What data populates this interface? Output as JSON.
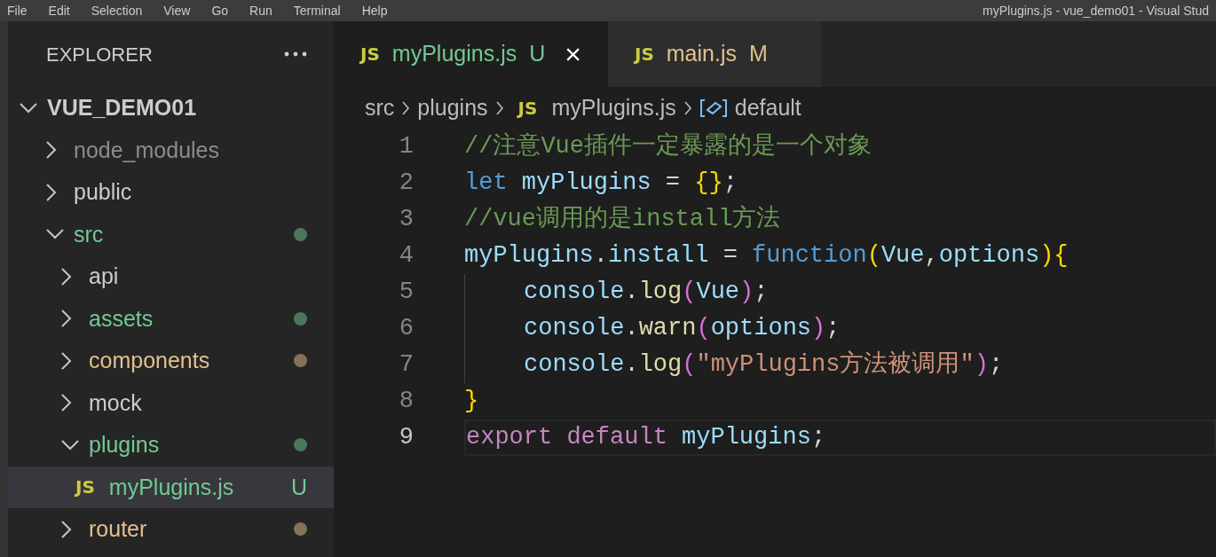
{
  "menu_bar": {
    "items": [
      "File",
      "Edit",
      "Selection",
      "View",
      "Go",
      "Run",
      "Terminal",
      "Help"
    ],
    "title": "myPlugins.js - vue_demo01 - Visual Stud"
  },
  "explorer": {
    "title": "EXPLORER"
  },
  "tree": [
    {
      "label": "VUE_DEMO01",
      "kind": "folder",
      "expanded": true,
      "selected": false,
      "color": "#cccccc",
      "dot": false,
      "children": [
        {
          "label": "node_modules",
          "kind": "folder",
          "expanded": false,
          "selected": false,
          "color": "#8c8c8c",
          "dot": false
        },
        {
          "label": "public",
          "kind": "folder",
          "expanded": false,
          "selected": false,
          "color": "#cccccc",
          "dot": false
        },
        {
          "label": "src",
          "kind": "folder",
          "expanded": true,
          "selected": false,
          "color": "#73c991",
          "dot": true,
          "children": [
            {
              "label": "api",
              "kind": "folder",
              "expanded": false,
              "selected": false,
              "color": "#cccccc",
              "dot": false
            },
            {
              "label": "assets",
              "kind": "folder",
              "expanded": false,
              "selected": false,
              "color": "#73c991",
              "dot": true
            },
            {
              "label": "components",
              "kind": "folder",
              "expanded": false,
              "selected": false,
              "color": "#e2c08d",
              "dot": true
            },
            {
              "label": "mock",
              "kind": "folder",
              "expanded": false,
              "selected": false,
              "color": "#cccccc",
              "dot": false
            },
            {
              "label": "plugins",
              "kind": "folder",
              "expanded": true,
              "selected": false,
              "color": "#73c991",
              "dot": true,
              "children": [
                {
                  "label": "myPlugins.js",
                  "kind": "file",
                  "icon": "JS",
                  "badge": "U",
                  "selected": true,
                  "color": "#73c991"
                }
              ]
            },
            {
              "label": "router",
              "kind": "folder",
              "expanded": false,
              "selected": false,
              "color": "#e2c08d",
              "dot": true
            }
          ]
        }
      ]
    }
  ],
  "tabs": [
    {
      "icon": "JS",
      "label": "myPlugins.js",
      "badge": "U",
      "color": "#73c991",
      "selected": true,
      "close": "×"
    },
    {
      "icon": "JS",
      "label": "main.js",
      "badge": "M",
      "color": "#e2c08d",
      "selected": false
    }
  ],
  "breadcrumbs": [
    {
      "label": "src",
      "kind": "folder"
    },
    {
      "label": "plugins",
      "kind": "folder"
    },
    {
      "label": "myPlugins.js",
      "kind": "file",
      "icon": "JS"
    },
    {
      "label": "default",
      "kind": "symbol"
    }
  ],
  "code": [
    {
      "number": "1",
      "current": false,
      "indent_guide": false,
      "tokens": [
        {
          "text": "//注意Vue插件一定暴露的是一个对象",
          "kind": "comment"
        }
      ]
    },
    {
      "number": "2",
      "current": false,
      "indent_guide": false,
      "tokens": [
        {
          "text": "let ",
          "kind": "keyword"
        },
        {
          "text": "myPlugins",
          "kind": "variable"
        },
        {
          "text": " = ",
          "kind": "plain"
        },
        {
          "text": "{}",
          "kind": "bracket1"
        },
        {
          "text": ";",
          "kind": "plain"
        }
      ]
    },
    {
      "number": "3",
      "current": false,
      "indent_guide": false,
      "tokens": [
        {
          "text": "//vue调用的是install方法",
          "kind": "comment"
        }
      ]
    },
    {
      "number": "4",
      "current": false,
      "indent_guide": false,
      "tokens": [
        {
          "text": "myPlugins",
          "kind": "variable"
        },
        {
          "text": ".",
          "kind": "plain"
        },
        {
          "text": "install",
          "kind": "variable"
        },
        {
          "text": " = ",
          "kind": "plain"
        },
        {
          "text": "function",
          "kind": "keyword"
        },
        {
          "text": "(",
          "kind": "bracket1"
        },
        {
          "text": "Vue",
          "kind": "variable"
        },
        {
          "text": ",",
          "kind": "plain"
        },
        {
          "text": "options",
          "kind": "variable"
        },
        {
          "text": "){",
          "kind": "bracket1"
        }
      ]
    },
    {
      "number": "5",
      "current": false,
      "indent_guide": true,
      "tokens": [
        {
          "text": "console",
          "kind": "variable"
        },
        {
          "text": ".",
          "kind": "plain"
        },
        {
          "text": "log",
          "kind": "function"
        },
        {
          "text": "(",
          "kind": "bracket2"
        },
        {
          "text": "Vue",
          "kind": "variable"
        },
        {
          "text": ")",
          "kind": "bracket2"
        },
        {
          "text": ";",
          "kind": "plain"
        }
      ]
    },
    {
      "number": "6",
      "current": false,
      "indent_guide": true,
      "tokens": [
        {
          "text": "console",
          "kind": "variable"
        },
        {
          "text": ".",
          "kind": "plain"
        },
        {
          "text": "warn",
          "kind": "function"
        },
        {
          "text": "(",
          "kind": "bracket2"
        },
        {
          "text": "options",
          "kind": "variable"
        },
        {
          "text": ")",
          "kind": "bracket2"
        },
        {
          "text": ";",
          "kind": "plain"
        }
      ]
    },
    {
      "number": "7",
      "current": false,
      "indent_guide": true,
      "tokens": [
        {
          "text": "console",
          "kind": "variable"
        },
        {
          "text": ".",
          "kind": "plain"
        },
        {
          "text": "log",
          "kind": "function"
        },
        {
          "text": "(",
          "kind": "bracket2"
        },
        {
          "text": "\"myPlugins方法被调用\"",
          "kind": "string"
        },
        {
          "text": ")",
          "kind": "bracket2"
        },
        {
          "text": ";",
          "kind": "plain"
        }
      ]
    },
    {
      "number": "8",
      "current": false,
      "indent_guide": false,
      "tokens": [
        {
          "text": "}",
          "kind": "bracket1"
        }
      ]
    },
    {
      "number": "9",
      "current": true,
      "indent_guide": false,
      "tokens": [
        {
          "text": "export ",
          "kind": "control"
        },
        {
          "text": "default ",
          "kind": "control"
        },
        {
          "text": "myPlugins",
          "kind": "variable"
        },
        {
          "text": ";",
          "kind": "plain"
        }
      ]
    }
  ]
}
